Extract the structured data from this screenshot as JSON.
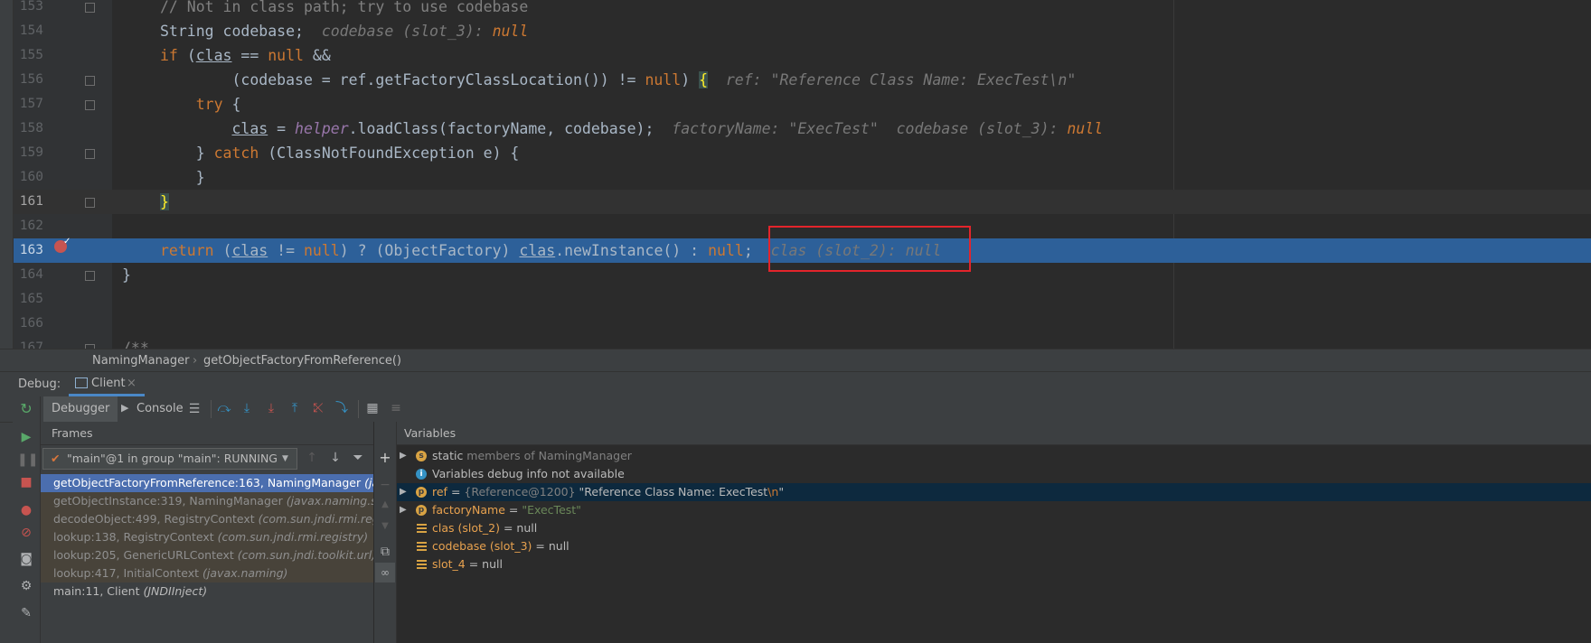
{
  "editor": {
    "lines": [
      {
        "num": "153",
        "parts": [
          [
            "cm",
            "// Not in class path; try to use codebase"
          ]
        ]
      },
      {
        "num": "154",
        "parts": [
          [
            "txt",
            "String codebase;  "
          ],
          [
            "hint",
            "codebase (slot_3): "
          ],
          [
            "hintnull",
            "null"
          ]
        ]
      },
      {
        "num": "155",
        "parts": [
          [
            "kw",
            "if "
          ],
          [
            "txt",
            "("
          ],
          [
            "ul",
            "clas"
          ],
          [
            "txt",
            " == "
          ],
          [
            "kw",
            "null "
          ],
          [
            "txt",
            "&&"
          ]
        ]
      },
      {
        "num": "156",
        "parts": [
          [
            "txt",
            "        (codebase = ref.getFactoryClassLocation()) != "
          ],
          [
            "kw",
            "null"
          ],
          [
            "txt",
            ") "
          ],
          [
            "brace",
            "{"
          ],
          [
            "txt",
            "  "
          ],
          [
            "hint",
            "ref: \"Reference Class Name: ExecTest\\n\""
          ]
        ]
      },
      {
        "num": "157",
        "parts": [
          [
            "kw",
            "    try "
          ],
          [
            "txt",
            "{"
          ]
        ]
      },
      {
        "num": "158",
        "parts": [
          [
            "txt",
            "        "
          ],
          [
            "ul",
            "clas"
          ],
          [
            "txt",
            " = "
          ],
          [
            "fld",
            "helper"
          ],
          [
            "txt",
            ".loadClass(factoryName, codebase);  "
          ],
          [
            "hint",
            "factoryName: \"ExecTest\"  codebase (slot_3): "
          ],
          [
            "hintnull",
            "null"
          ]
        ]
      },
      {
        "num": "159",
        "parts": [
          [
            "txt",
            "    } "
          ],
          [
            "kw",
            "catch "
          ],
          [
            "txt",
            "(ClassNotFoundException e) {"
          ]
        ]
      },
      {
        "num": "160",
        "parts": [
          [
            "txt",
            "    }"
          ]
        ]
      },
      {
        "num": "161",
        "parts": [
          [
            "brace",
            "}"
          ]
        ]
      },
      {
        "num": "162",
        "parts": []
      },
      {
        "num": "163",
        "parts": [
          [
            "kw",
            "return "
          ],
          [
            "txt",
            "("
          ],
          [
            "ul",
            "clas"
          ],
          [
            "txt",
            " != "
          ],
          [
            "kw",
            "null"
          ],
          [
            "txt",
            ") ? (ObjectFactory) "
          ],
          [
            "ul",
            "clas"
          ],
          [
            "txt",
            ".newInstance() : "
          ],
          [
            "kw",
            "null"
          ],
          [
            "txt",
            ";  "
          ],
          [
            "hint",
            "clas (slot_2): null"
          ]
        ]
      },
      {
        "num": "164",
        "parts": [
          [
            "txt",
            "}"
          ]
        ]
      },
      {
        "num": "165",
        "parts": []
      },
      {
        "num": "166",
        "parts": []
      },
      {
        "num": "167",
        "parts": [
          [
            "cm",
            "/**"
          ]
        ]
      }
    ]
  },
  "breadcrumb": {
    "class_name": "NamingManager",
    "method": "getObjectFactoryFromReference()",
    "sep": "›"
  },
  "debug": {
    "label": "Debug:",
    "session": "Client",
    "close": "×"
  },
  "tabs": {
    "debugger": "Debugger",
    "console": "Console"
  },
  "frames": {
    "title": "Frames",
    "thread": "\"main\"@1 in group \"main\": RUNNING",
    "items": [
      {
        "text": "getObjectFactoryFromReference:163, NamingManager ",
        "pkg": "(javax.naming.spi)",
        "kind": "sel"
      },
      {
        "text": "getObjectInstance:319, NamingManager ",
        "pkg": "(javax.naming.spi)",
        "kind": "lib"
      },
      {
        "text": "decodeObject:499, RegistryContext ",
        "pkg": "(com.sun.jndi.rmi.registry)",
        "kind": "lib"
      },
      {
        "text": "lookup:138, RegistryContext ",
        "pkg": "(com.sun.jndi.rmi.registry)",
        "kind": "lib"
      },
      {
        "text": "lookup:205, GenericURLContext ",
        "pkg": "(com.sun.jndi.toolkit.url)",
        "kind": "lib"
      },
      {
        "text": "lookup:417, InitialContext ",
        "pkg": "(javax.naming)",
        "kind": "lib"
      },
      {
        "text": "main:11, Client ",
        "pkg": "(JNDIInject)",
        "kind": "normal"
      }
    ]
  },
  "variables": {
    "title": "Variables",
    "items": [
      {
        "kind": "static",
        "name": "static",
        "rest": " members of NamingManager",
        "badge": "s"
      },
      {
        "kind": "info",
        "name": "Variables debug info not available",
        "badge": "i"
      },
      {
        "kind": "ref",
        "name": "ref",
        "eq": " = ",
        "type": "{Reference@1200} ",
        "str": "\"Reference Class Name: ExecTest",
        "esc": "\\n",
        "end": "\"",
        "badge": "p"
      },
      {
        "kind": "param",
        "name": "factoryName",
        "eq": " = ",
        "str": "\"ExecTest\"",
        "badge": "p"
      },
      {
        "kind": "local",
        "name": "clas (slot_2)",
        "eq": " = ",
        "val": "null"
      },
      {
        "kind": "local",
        "name": "codebase (slot_3)",
        "eq": " = ",
        "val": "null"
      },
      {
        "kind": "local",
        "name": "slot_4",
        "eq": " = ",
        "val": "null"
      }
    ]
  },
  "colors": {
    "exec_line": "#2d6099",
    "breakpoint": "#c75450",
    "highlight_box": "#e3242b"
  },
  "icons": [
    "rerun-icon",
    "resume-icon",
    "pause-icon",
    "stop-icon",
    "view-breakpoints-icon",
    "mute-breakpoints-icon",
    "camera-icon",
    "settings-icon",
    "pin-icon",
    "step-over-icon",
    "step-into-icon",
    "force-step-into-icon",
    "step-out-icon",
    "drop-frame-icon",
    "run-to-cursor-icon",
    "evaluate-icon",
    "threads-icon",
    "filter-icon",
    "add-watch-icon",
    "copy-icon",
    "glasses-icon"
  ]
}
